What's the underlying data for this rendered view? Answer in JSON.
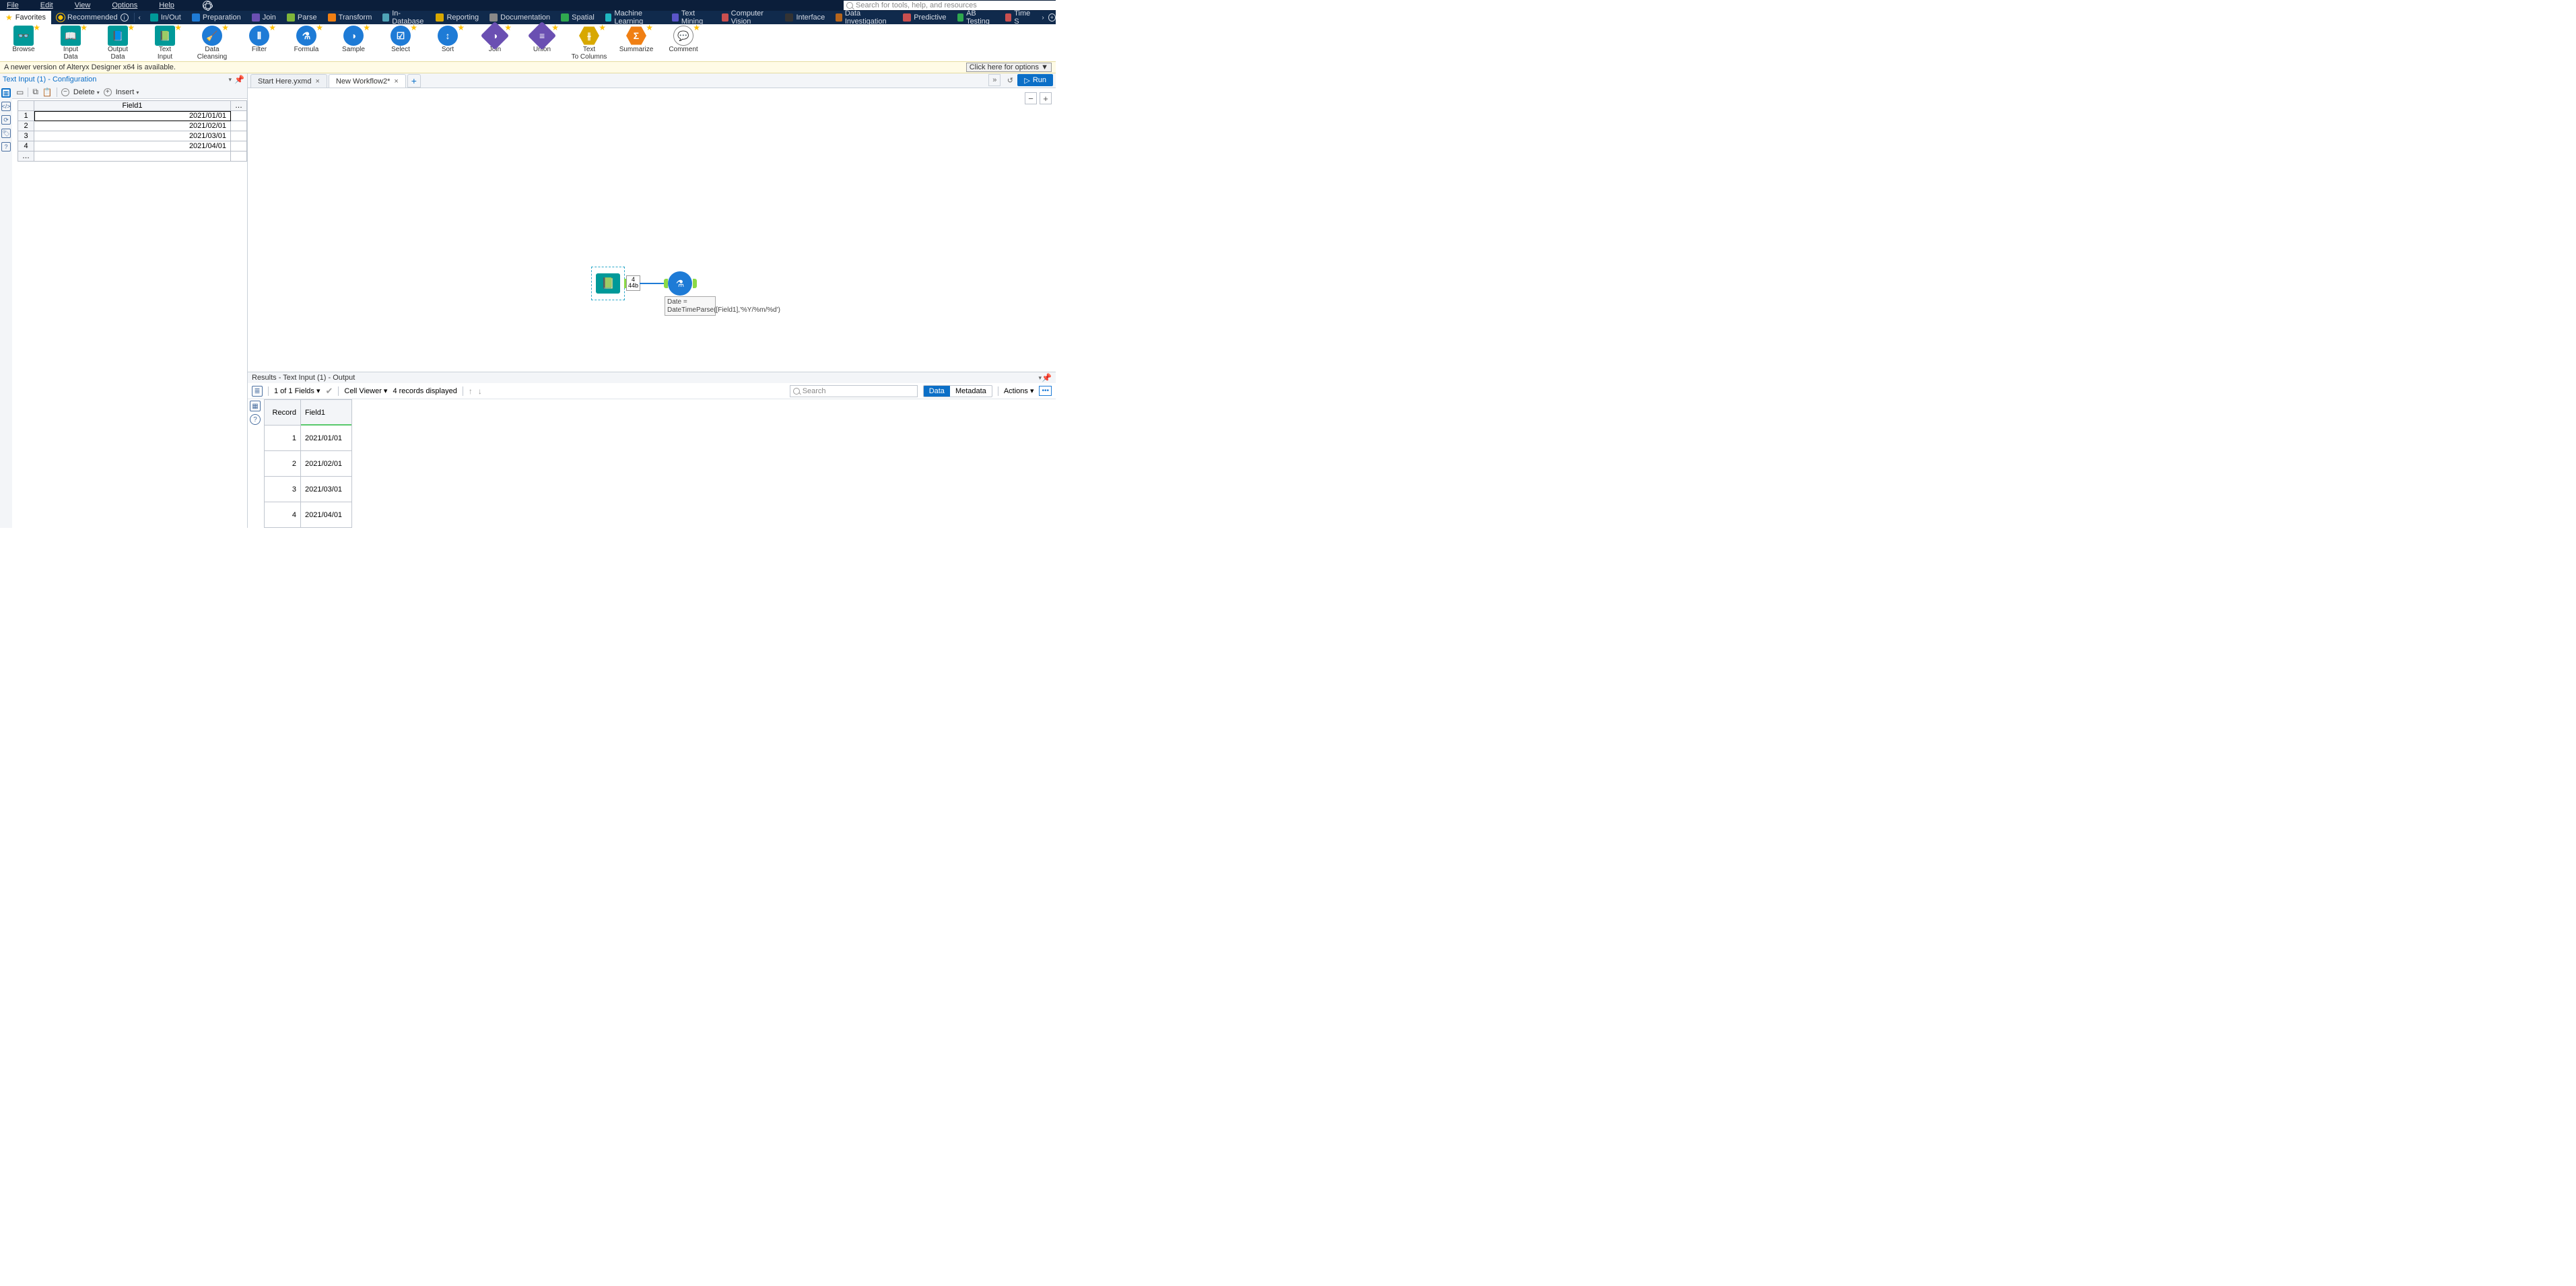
{
  "menu": {
    "file": "File",
    "edit": "Edit",
    "view": "View",
    "options": "Options",
    "help": "Help"
  },
  "search_placeholder": "Search for tools, help, and resources",
  "categories": {
    "favorites": "Favorites",
    "recommended": "Recommended",
    "items": [
      {
        "label": "In/Out",
        "color": "#009999"
      },
      {
        "label": "Preparation",
        "color": "#1e7bd6"
      },
      {
        "label": "Join",
        "color": "#6a4fb2"
      },
      {
        "label": "Parse",
        "color": "#7fb53a"
      },
      {
        "label": "Transform",
        "color": "#f07f13"
      },
      {
        "label": "In-Database",
        "color": "#4fa3b6"
      },
      {
        "label": "Reporting",
        "color": "#d8a800"
      },
      {
        "label": "Documentation",
        "color": "#888888"
      },
      {
        "label": "Spatial",
        "color": "#2fa84f"
      },
      {
        "label": "Machine Learning",
        "color": "#1fb6c1"
      },
      {
        "label": "Text Mining",
        "color": "#5a55c9"
      },
      {
        "label": "Computer Vision",
        "color": "#c94f4f"
      },
      {
        "label": "Interface",
        "color": "#333333"
      },
      {
        "label": "Data Investigation",
        "color": "#b5651d"
      },
      {
        "label": "Predictive",
        "color": "#c94f4f"
      },
      {
        "label": "AB Testing",
        "color": "#2fa84f"
      },
      {
        "label": "Time S",
        "color": "#c94f4f"
      }
    ]
  },
  "tools": [
    {
      "label": "Browse",
      "shape": "sq",
      "color": "c-teal",
      "glyph": "👓"
    },
    {
      "label": "Input Data",
      "shape": "sq",
      "color": "c-teal",
      "glyph": "📖"
    },
    {
      "label": "Output Data",
      "shape": "sq",
      "color": "c-teal",
      "glyph": "📘"
    },
    {
      "label": "Text Input",
      "shape": "sq",
      "color": "c-teal",
      "glyph": "📗"
    },
    {
      "label": "Data Cleansing",
      "shape": "circle",
      "color": "c-blue",
      "glyph": "🧹"
    },
    {
      "label": "Filter",
      "shape": "circle",
      "color": "c-blue",
      "glyph": "⫴"
    },
    {
      "label": "Formula",
      "shape": "circle",
      "color": "c-blue",
      "glyph": "⚗"
    },
    {
      "label": "Sample",
      "shape": "circle",
      "color": "c-blue",
      "glyph": "◑"
    },
    {
      "label": "Select",
      "shape": "circle",
      "color": "c-blue",
      "glyph": "☑"
    },
    {
      "label": "Sort",
      "shape": "circle",
      "color": "c-blue",
      "glyph": "↕"
    },
    {
      "label": "Join",
      "shape": "diamond",
      "color": "c-purple",
      "glyph": "◑"
    },
    {
      "label": "Union",
      "shape": "diamond",
      "color": "c-purple",
      "glyph": "≡"
    },
    {
      "label": "Text To Columns",
      "shape": "hex",
      "color": "c-yellow",
      "glyph": "⫳"
    },
    {
      "label": "Summarize",
      "shape": "hex",
      "color": "c-orange",
      "glyph": "Σ"
    },
    {
      "label": "Comment",
      "shape": "circle",
      "color": "",
      "glyph": "💬"
    }
  ],
  "notice": {
    "text": "A newer version of Alteryx Designer x64 is available.",
    "button": "Click here for options ▼"
  },
  "config": {
    "title": "Text Input (1) - Configuration",
    "toolbar": {
      "delete": "Delete",
      "insert": "Insert"
    },
    "header": "Field1",
    "rows": [
      {
        "n": "1",
        "v": "2021/01/01"
      },
      {
        "n": "2",
        "v": "2021/02/01"
      },
      {
        "n": "3",
        "v": "2021/03/01"
      },
      {
        "n": "4",
        "v": "2021/04/01"
      }
    ]
  },
  "tabs": [
    {
      "label": "Start Here.yxmd",
      "active": false
    },
    {
      "label": "New Workflow2*",
      "active": true
    }
  ],
  "run": "Run",
  "canvas": {
    "recinfo_top": "4",
    "recinfo_bottom": "44b",
    "annotation": "Date = DateTimeParse([Field1],'%Y/%m/%d')"
  },
  "results": {
    "title": "Results - Text Input (1) - Output",
    "fields_label": "1 of 1 Fields",
    "cellviewer": "Cell Viewer",
    "records": "4 records displayed",
    "search": "Search",
    "data": "Data",
    "metadata": "Metadata",
    "actions": "Actions",
    "cols": {
      "record": "Record",
      "field1": "Field1"
    },
    "rows": [
      {
        "r": "1",
        "v": "2021/01/01"
      },
      {
        "r": "2",
        "v": "2021/02/01"
      },
      {
        "r": "3",
        "v": "2021/03/01"
      },
      {
        "r": "4",
        "v": "2021/04/01"
      }
    ]
  }
}
